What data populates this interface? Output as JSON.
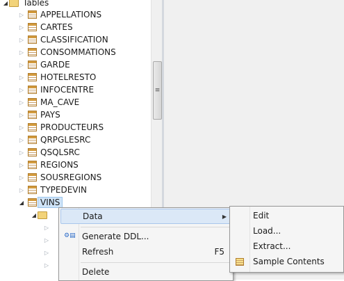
{
  "tree": {
    "root_label": "Tables",
    "tables": [
      "APPELLATIONS",
      "CARTES",
      "CLASSIFICATION",
      "CONSOMMATIONS",
      "GARDE",
      "HOTELRESTO",
      "INFOCENTRE",
      "MA_CAVE",
      "PAYS",
      "PRODUCTEURS",
      "QRPGLESRC",
      "QSQLSRC",
      "REGIONS",
      "SOUSREGIONS",
      "TYPEDEVIN",
      "VINS"
    ],
    "selected": "VINS"
  },
  "context_menu": {
    "data_label": "Data",
    "generate_ddl_label": "Generate DDL...",
    "refresh_label": "Refresh",
    "refresh_shortcut": "F5",
    "delete_label": "Delete"
  },
  "data_submenu": {
    "edit_label": "Edit",
    "load_label": "Load...",
    "extract_label": "Extract...",
    "sample_contents_label": "Sample Contents"
  },
  "colors": {
    "selection_bg": "#cfe4f8",
    "menu_highlight": "#dbe8f7",
    "menu_bg": "#f5f5f5"
  }
}
